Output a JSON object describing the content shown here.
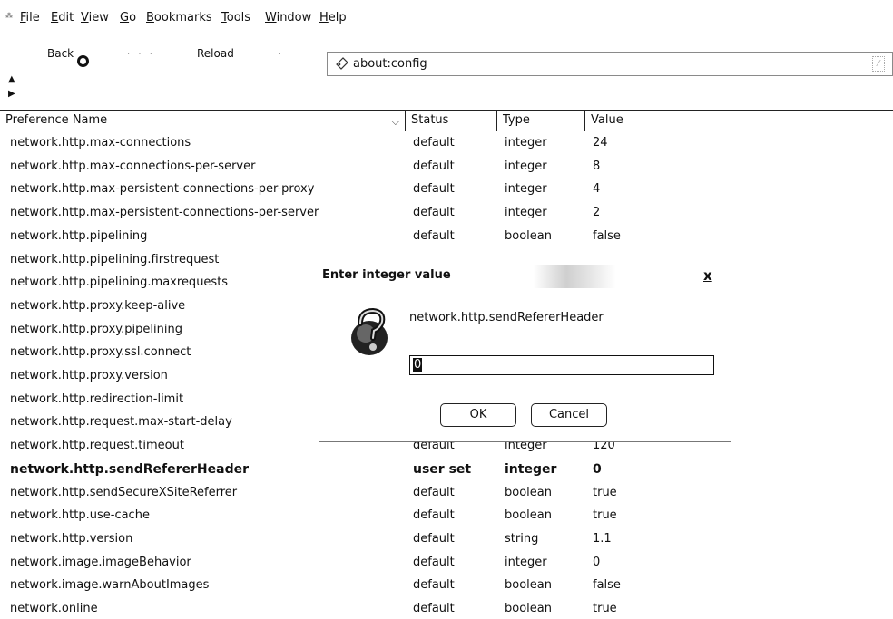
{
  "menubar": {
    "grip": "⁂",
    "items": [
      {
        "key": "F",
        "rest": "ile"
      },
      {
        "key": "E",
        "rest": "dit"
      },
      {
        "key": "V",
        "rest": "iew"
      },
      {
        "key": "G",
        "rest": "o"
      },
      {
        "key": "B",
        "rest": "ookmarks"
      },
      {
        "key": "T",
        "rest": "ools"
      },
      {
        "key": "W",
        "rest": "indow"
      },
      {
        "key": "H",
        "rest": "elp"
      }
    ]
  },
  "toolbar": {
    "back_label": "Back",
    "reload_label": "Reload",
    "url": "about:config"
  },
  "table": {
    "headers": [
      "Preference Name",
      "Status",
      "Type",
      "Value"
    ],
    "rows": [
      {
        "name": "network.http.max-connections",
        "status": "default",
        "type": "integer",
        "value": "24"
      },
      {
        "name": "network.http.max-connections-per-server",
        "status": "default",
        "type": "integer",
        "value": "8"
      },
      {
        "name": "network.http.max-persistent-connections-per-proxy",
        "status": "default",
        "type": "integer",
        "value": "4"
      },
      {
        "name": "network.http.max-persistent-connections-per-server",
        "status": "default",
        "type": "integer",
        "value": "2"
      },
      {
        "name": "network.http.pipelining",
        "status": "default",
        "type": "boolean",
        "value": "false"
      },
      {
        "name": "network.http.pipelining.firstrequest",
        "status": "",
        "type": "",
        "value": ""
      },
      {
        "name": "network.http.pipelining.maxrequests",
        "status": "",
        "type": "",
        "value": ""
      },
      {
        "name": "network.http.proxy.keep-alive",
        "status": "",
        "type": "",
        "value": ""
      },
      {
        "name": "network.http.proxy.pipelining",
        "status": "",
        "type": "",
        "value": ""
      },
      {
        "name": "network.http.proxy.ssl.connect",
        "status": "",
        "type": "",
        "value": ""
      },
      {
        "name": "network.http.proxy.version",
        "status": "",
        "type": "",
        "value": ""
      },
      {
        "name": "network.http.redirection-limit",
        "status": "",
        "type": "",
        "value": ""
      },
      {
        "name": "network.http.request.max-start-delay",
        "status": "",
        "type": "",
        "value": ""
      },
      {
        "name": "network.http.request.timeout",
        "status": "default",
        "type": "integer",
        "value": "120"
      },
      {
        "name": "network.http.sendRefererHeader",
        "status": "user set",
        "type": "integer",
        "value": "0",
        "bold": true
      },
      {
        "name": "network.http.sendSecureXSiteReferrer",
        "status": "default",
        "type": "boolean",
        "value": "true"
      },
      {
        "name": "network.http.use-cache",
        "status": "default",
        "type": "boolean",
        "value": "true"
      },
      {
        "name": "network.http.version",
        "status": "default",
        "type": "string",
        "value": "1.1"
      },
      {
        "name": "network.image.imageBehavior",
        "status": "default",
        "type": "integer",
        "value": "0"
      },
      {
        "name": "network.image.warnAboutImages",
        "status": "default",
        "type": "boolean",
        "value": "false"
      },
      {
        "name": "network.online",
        "status": "default",
        "type": "boolean",
        "value": "true"
      }
    ]
  },
  "dialog": {
    "title": "Enter integer value",
    "close": "x",
    "pref_name": "network.http.sendRefererHeader",
    "input_value": "0",
    "ok_label": "OK",
    "cancel_label": "Cancel"
  },
  "icons": {
    "url_icon": "page-icon",
    "dialog_icon": "question-icon"
  }
}
